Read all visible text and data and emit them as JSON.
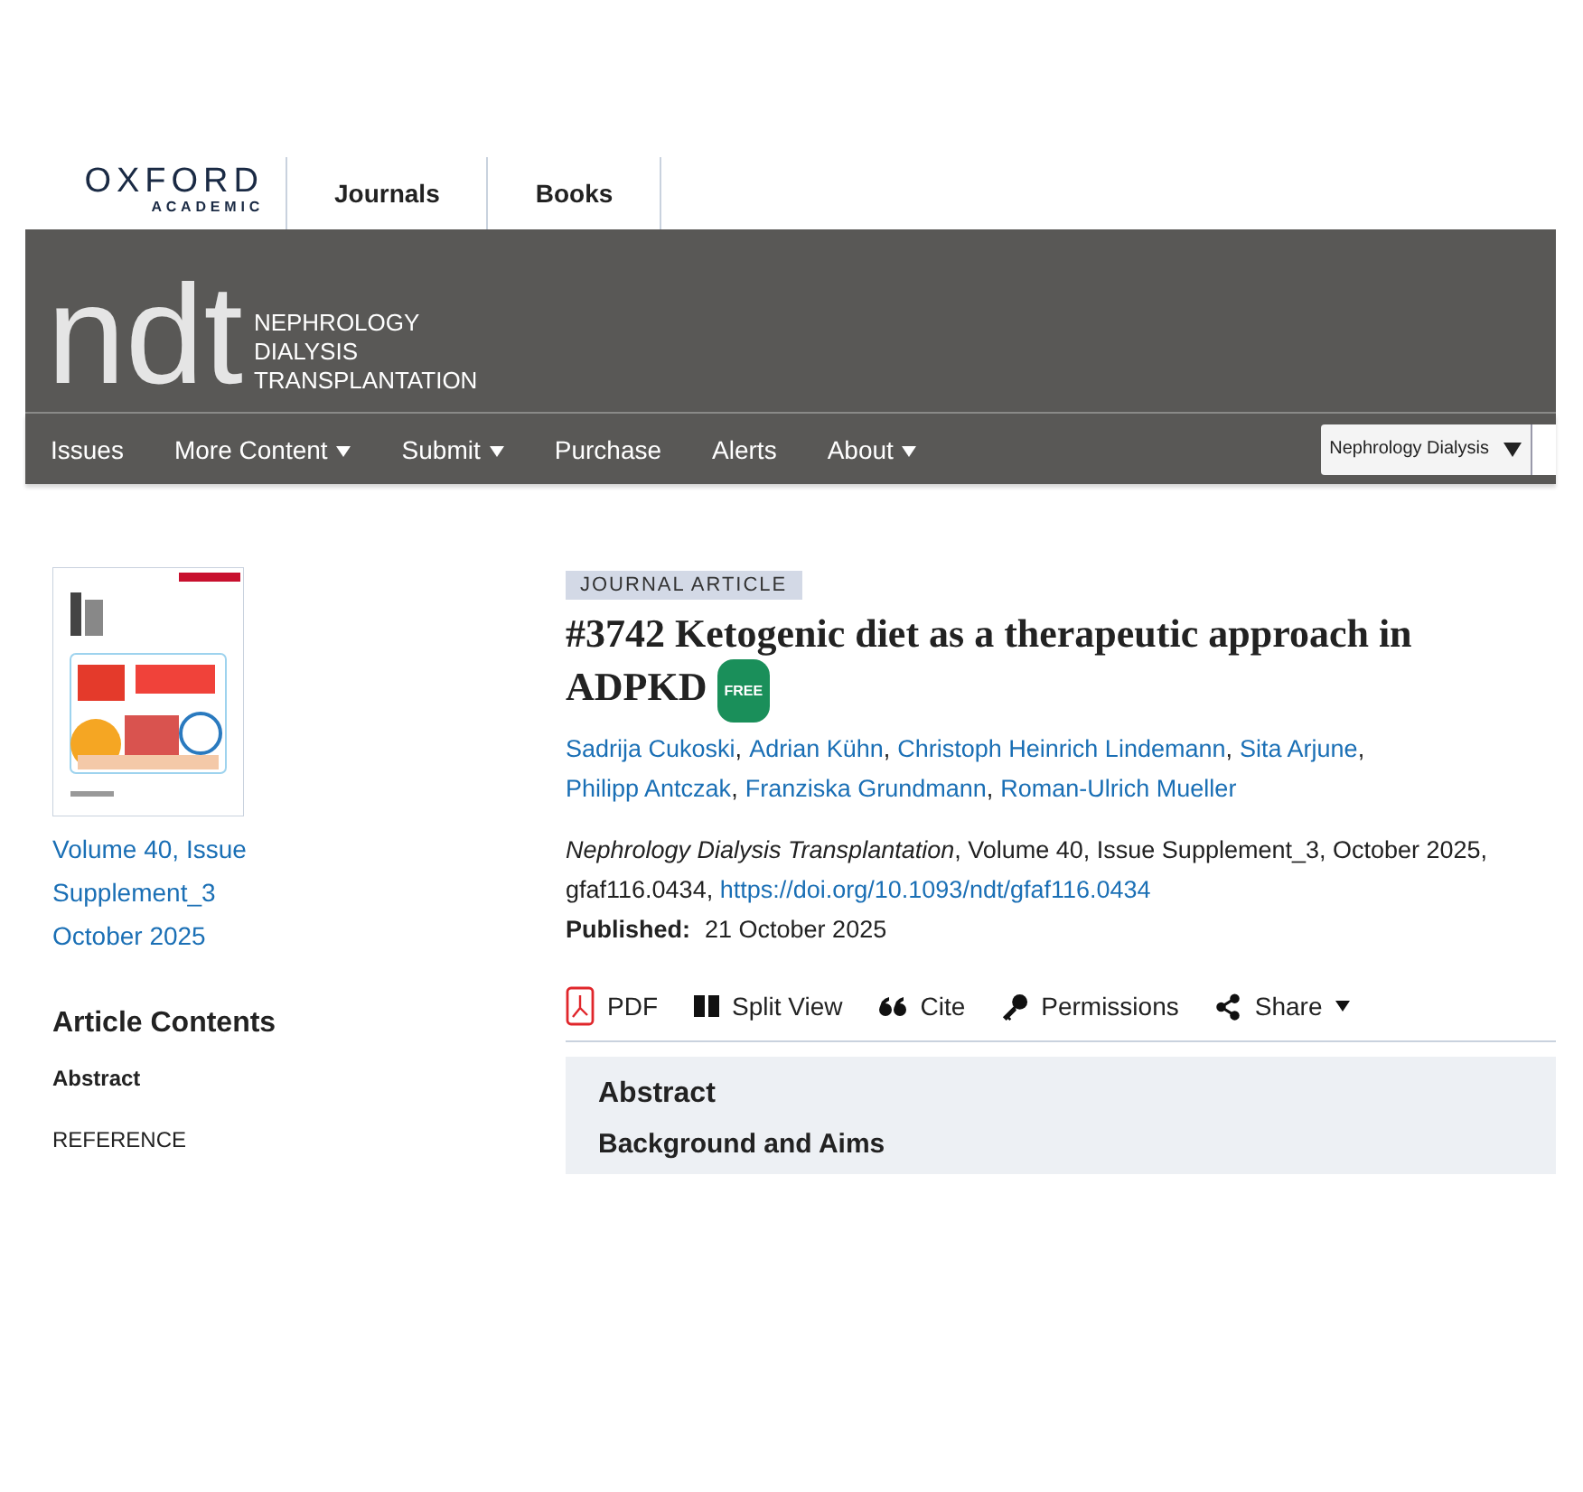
{
  "site_header": {
    "logo": {
      "top": "OXFORD",
      "bottom": "ACADEMIC"
    },
    "links": [
      "Journals",
      "Books"
    ]
  },
  "journal_banner": {
    "logo_mark": "ndt",
    "name_lines": [
      "NEPHROLOGY",
      "DIALYSIS",
      "TRANSPLANTATION"
    ]
  },
  "nav": {
    "items": [
      {
        "label": "Issues",
        "has_menu": false
      },
      {
        "label": "More Content",
        "has_menu": true
      },
      {
        "label": "Submit",
        "has_menu": true
      },
      {
        "label": "Purchase",
        "has_menu": false
      },
      {
        "label": "Alerts",
        "has_menu": false
      },
      {
        "label": "About",
        "has_menu": true
      }
    ],
    "search_scope": "Nephrology Dialysis"
  },
  "sidebar": {
    "issue_lines": [
      "Volume 40, Issue",
      "Supplement_3",
      "October 2025"
    ],
    "contents_title": "Article Contents",
    "contents": [
      {
        "label": "Abstract",
        "selected": true
      },
      {
        "label": "REFERENCE",
        "selected": false
      }
    ]
  },
  "article": {
    "type": "JOURNAL ARTICLE",
    "title": "#3742 Ketogenic diet as a therapeutic approach in ADPKD",
    "badge": "FREE",
    "authors": [
      "Sadrija Cukoski",
      "Adrian Kühn",
      "Christoph Heinrich Lindemann",
      "Sita Arjune",
      "Philipp Antczak",
      "Franziska Grundmann",
      "Roman-Ulrich Mueller"
    ],
    "author_separator": ",",
    "citation": "*Nephrology Dialysis Transplantation*, Volume 40, Issue Supplement_3, October 2025, gfaf116.0434,",
    "doi": "https://doi.org/10.1093/ndt/gfaf116.0434",
    "published_label": "Published:",
    "published_date": "21 October 2025",
    "tools": [
      {
        "kind": "pdf",
        "label": "PDF"
      },
      {
        "kind": "split",
        "label": "Split View"
      },
      {
        "kind": "cite",
        "label": "Cite"
      },
      {
        "kind": "key",
        "label": "Permissions"
      },
      {
        "kind": "share",
        "label": "Share"
      }
    ],
    "abstract": {
      "heading": "Abstract",
      "subheading": "Background and Aims"
    }
  }
}
